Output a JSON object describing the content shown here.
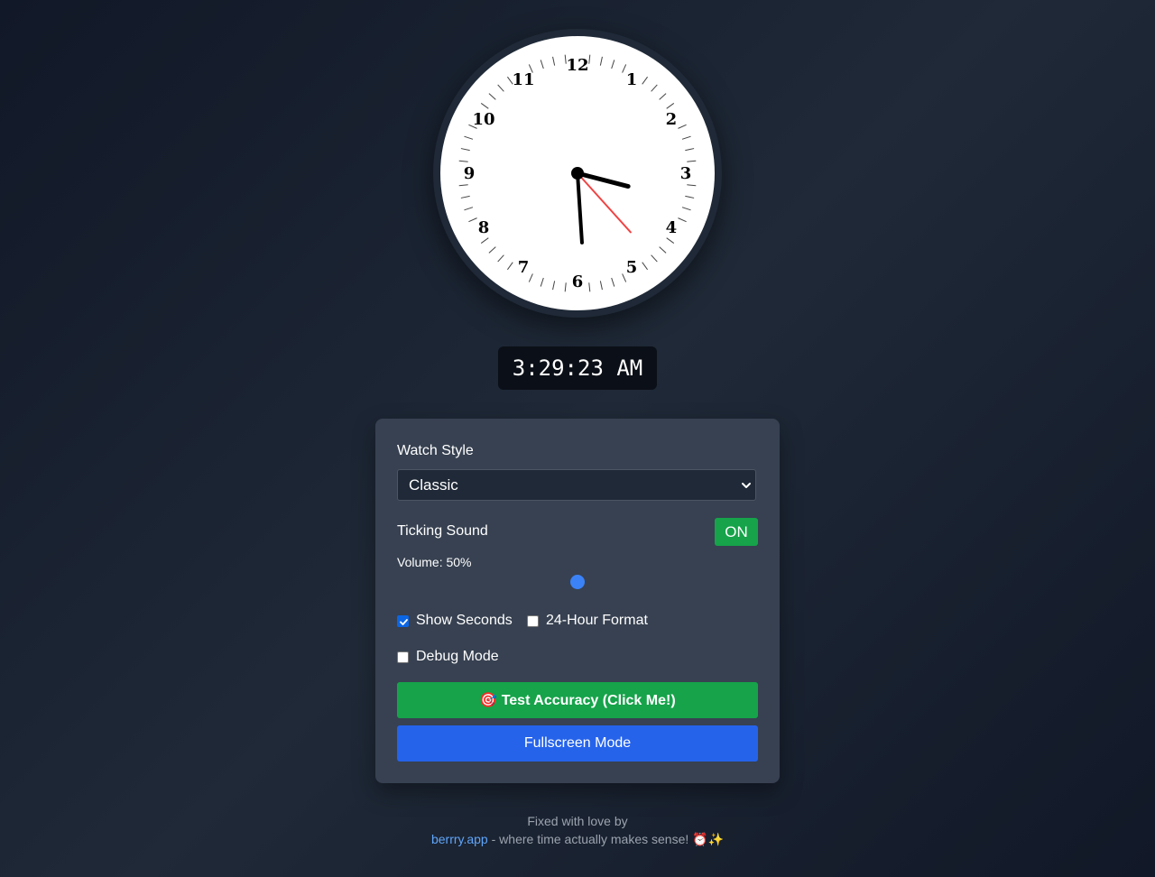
{
  "clock": {
    "numbers": [
      "12",
      "1",
      "2",
      "3",
      "4",
      "5",
      "6",
      "7",
      "8",
      "9",
      "10",
      "11"
    ],
    "time": {
      "hours": 3,
      "minutes": 29,
      "seconds": 23
    },
    "hand_colors": {
      "hour": "#000000",
      "minute": "#000000",
      "second": "#ef4444"
    }
  },
  "digital_time": "3:29:23 AM",
  "controls": {
    "watch_style_label": "Watch Style",
    "watch_style_value": "Classic",
    "ticking_sound_label": "Ticking Sound",
    "ticking_sound_toggle": "ON",
    "volume_label": "Volume: 50%",
    "volume_value": 0.5,
    "show_seconds_label": "Show Seconds",
    "show_seconds_checked": true,
    "hour24_label": "24-Hour Format",
    "hour24_checked": false,
    "debug_label": "Debug Mode",
    "debug_checked": false,
    "test_accuracy_label": "🎯 Test Accuracy (Click Me!)",
    "fullscreen_label": "Fullscreen Mode"
  },
  "footer": {
    "line1": "Fixed with love by",
    "link": "berrry.app",
    "line2_rest": " - where time actually makes sense! ⏰✨"
  },
  "colors": {
    "accent_green": "#16a34a",
    "accent_blue": "#2563eb",
    "slider_thumb": "#3b82f6",
    "link": "#60a5fa"
  }
}
